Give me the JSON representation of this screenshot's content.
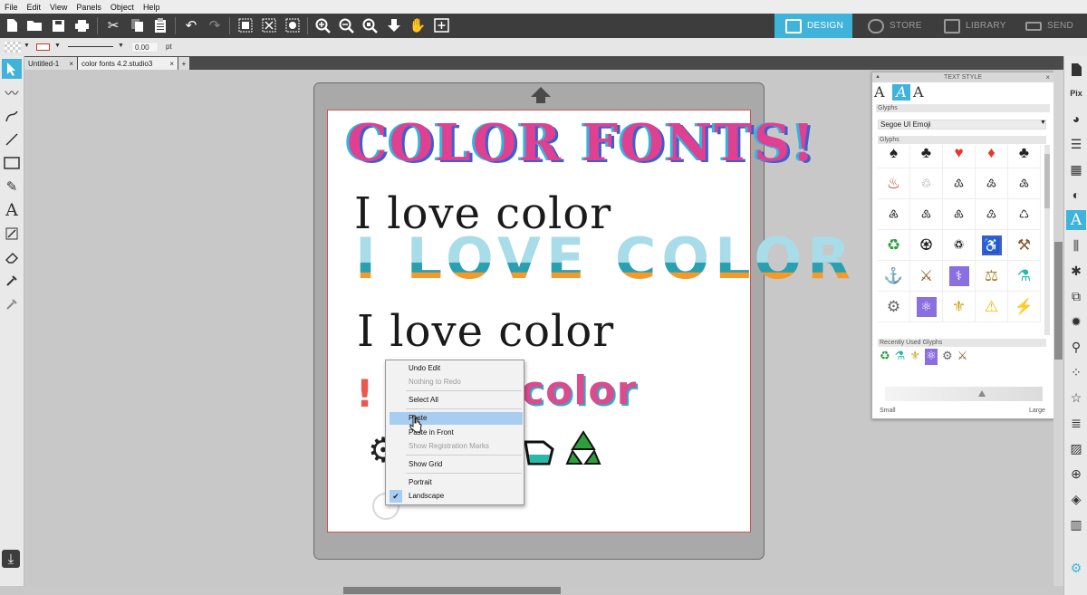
{
  "menu": [
    "File",
    "Edit",
    "View",
    "Panels",
    "Object",
    "Help"
  ],
  "nav_tabs": {
    "design": "DESIGN",
    "store": "STORE",
    "library": "LIBRARY",
    "send": "SEND"
  },
  "propbar": {
    "stroke_value": "0.00",
    "stroke_unit": "pt"
  },
  "doc_tabs": [
    "Untitled-1",
    "color fonts 4.2.studio3"
  ],
  "canvas": {
    "title": "COLOR FONTS!",
    "line1": "I love color",
    "line2": "I LOVE COLOR",
    "line3": "I love color",
    "line4_end": "color",
    "line4_start": "!"
  },
  "text_style_panel": {
    "title": "TEXT STYLE",
    "section_glyphs": "Glyphs",
    "font": "Segoe UI Emoji",
    "glyph_grid_label": "Glyphs",
    "recent_label": "Recently Used Glyphs",
    "size_small": "Small",
    "size_large": "Large"
  },
  "context_menu": {
    "undo": "Undo Edit",
    "redo": "Nothing to Redo",
    "select_all": "Select All",
    "paste": "Paste",
    "paste_front": "Paste in Front",
    "show_reg": "Show Registration Marks",
    "show_grid": "Show Grid",
    "portrait": "Portrait",
    "landscape": "Landscape"
  },
  "colors": {
    "accent": "#3fb3da",
    "toolbar": "#3d3d3d",
    "menu_highlight": "#a9cdf0"
  }
}
